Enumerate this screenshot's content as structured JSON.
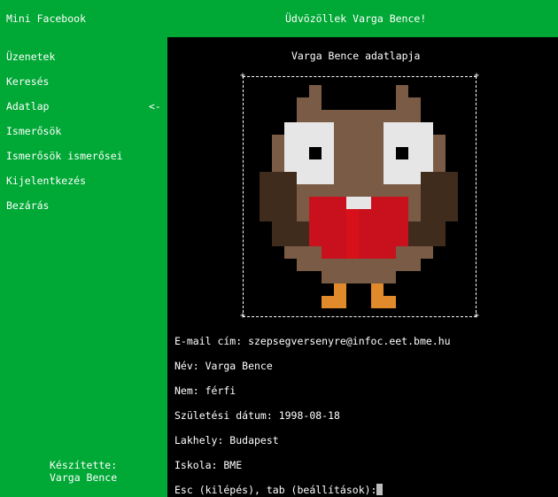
{
  "header": {
    "app_title": "Mini Facebook",
    "welcome": "Üdvözöllek Varga Bence!"
  },
  "sidebar": {
    "items": [
      {
        "label": "Üzenetek"
      },
      {
        "label": "Keresés"
      },
      {
        "label": "Adatlap",
        "marker": "<-"
      },
      {
        "label": "Ismerősök"
      },
      {
        "label": "Ismerősök ismerősei"
      },
      {
        "label": "Kijelentkezés"
      },
      {
        "label": "Bezárás"
      }
    ],
    "author_label": "Készítette:",
    "author_name": "Varga Bence"
  },
  "profile": {
    "title": "Varga Bence adatlapja",
    "avatar_icon": "owl-avatar",
    "email": "E-mail cím: szepsegversenyre@infoc.eet.bme.hu",
    "name": "Név: Varga Bence",
    "gender": "Nem: férfi",
    "birth_date": "Születési dátum: 1998-08-18",
    "residence": "Lakhely: Budapest",
    "school": "Iskola: BME"
  },
  "prompt": {
    "text": "Esc (kilépés), tab (beállítások):"
  },
  "colors": {
    "green": "#00a835",
    "background": "#000000",
    "owl_brown": "#7a5b45",
    "owl_dark": "#3f2c1c",
    "owl_red": "#c8111c",
    "owl_orange": "#e08a2c"
  }
}
